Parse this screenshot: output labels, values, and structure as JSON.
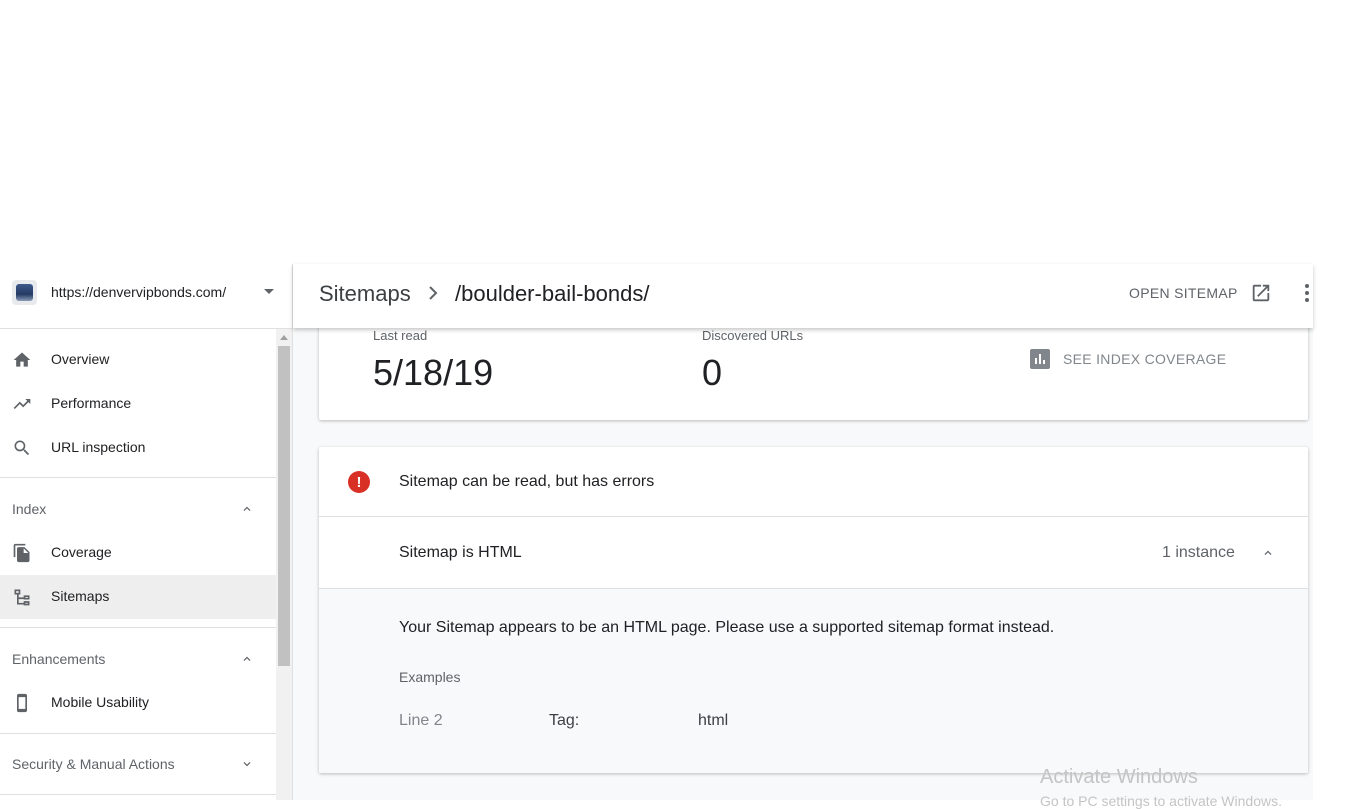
{
  "property": {
    "url": "https://denvervipbonds.com/"
  },
  "sidebar": {
    "items_top": [
      {
        "label": "Overview",
        "icon": "home-icon"
      },
      {
        "label": "Performance",
        "icon": "trending-up-icon"
      },
      {
        "label": "URL inspection",
        "icon": "search-icon"
      }
    ],
    "index": {
      "title": "Index",
      "items": [
        {
          "label": "Coverage",
          "icon": "copy-pages-icon"
        },
        {
          "label": "Sitemaps",
          "icon": "sitemap-tree-icon",
          "active": true
        }
      ]
    },
    "enhancements": {
      "title": "Enhancements",
      "items": [
        {
          "label": "Mobile Usability",
          "icon": "phone-icon"
        }
      ]
    },
    "security": {
      "title": "Security & Manual Actions"
    }
  },
  "header": {
    "breadcrumb_root": "Sitemaps",
    "breadcrumb_current": "/boulder-bail-bonds/",
    "open_sitemap": "OPEN SITEMAP"
  },
  "stats": {
    "last_read_label": "Last read",
    "last_read_value": "5/18/19",
    "discovered_label": "Discovered URLs",
    "discovered_value": "0",
    "see_coverage": "SEE INDEX COVERAGE"
  },
  "status": {
    "message": "Sitemap can be read, but has errors",
    "color": "#d93025"
  },
  "issue": {
    "title": "Sitemap is HTML",
    "count": "1 instance",
    "detail": "Your Sitemap appears to be an HTML page. Please use a supported sitemap format instead.",
    "examples_label": "Examples",
    "examples": [
      {
        "line": "Line 2",
        "tag_label": "Tag:",
        "tag_value": "html"
      }
    ]
  },
  "watermark": {
    "line1": "Activate Windows",
    "line2": "Go to PC settings to activate Windows."
  }
}
